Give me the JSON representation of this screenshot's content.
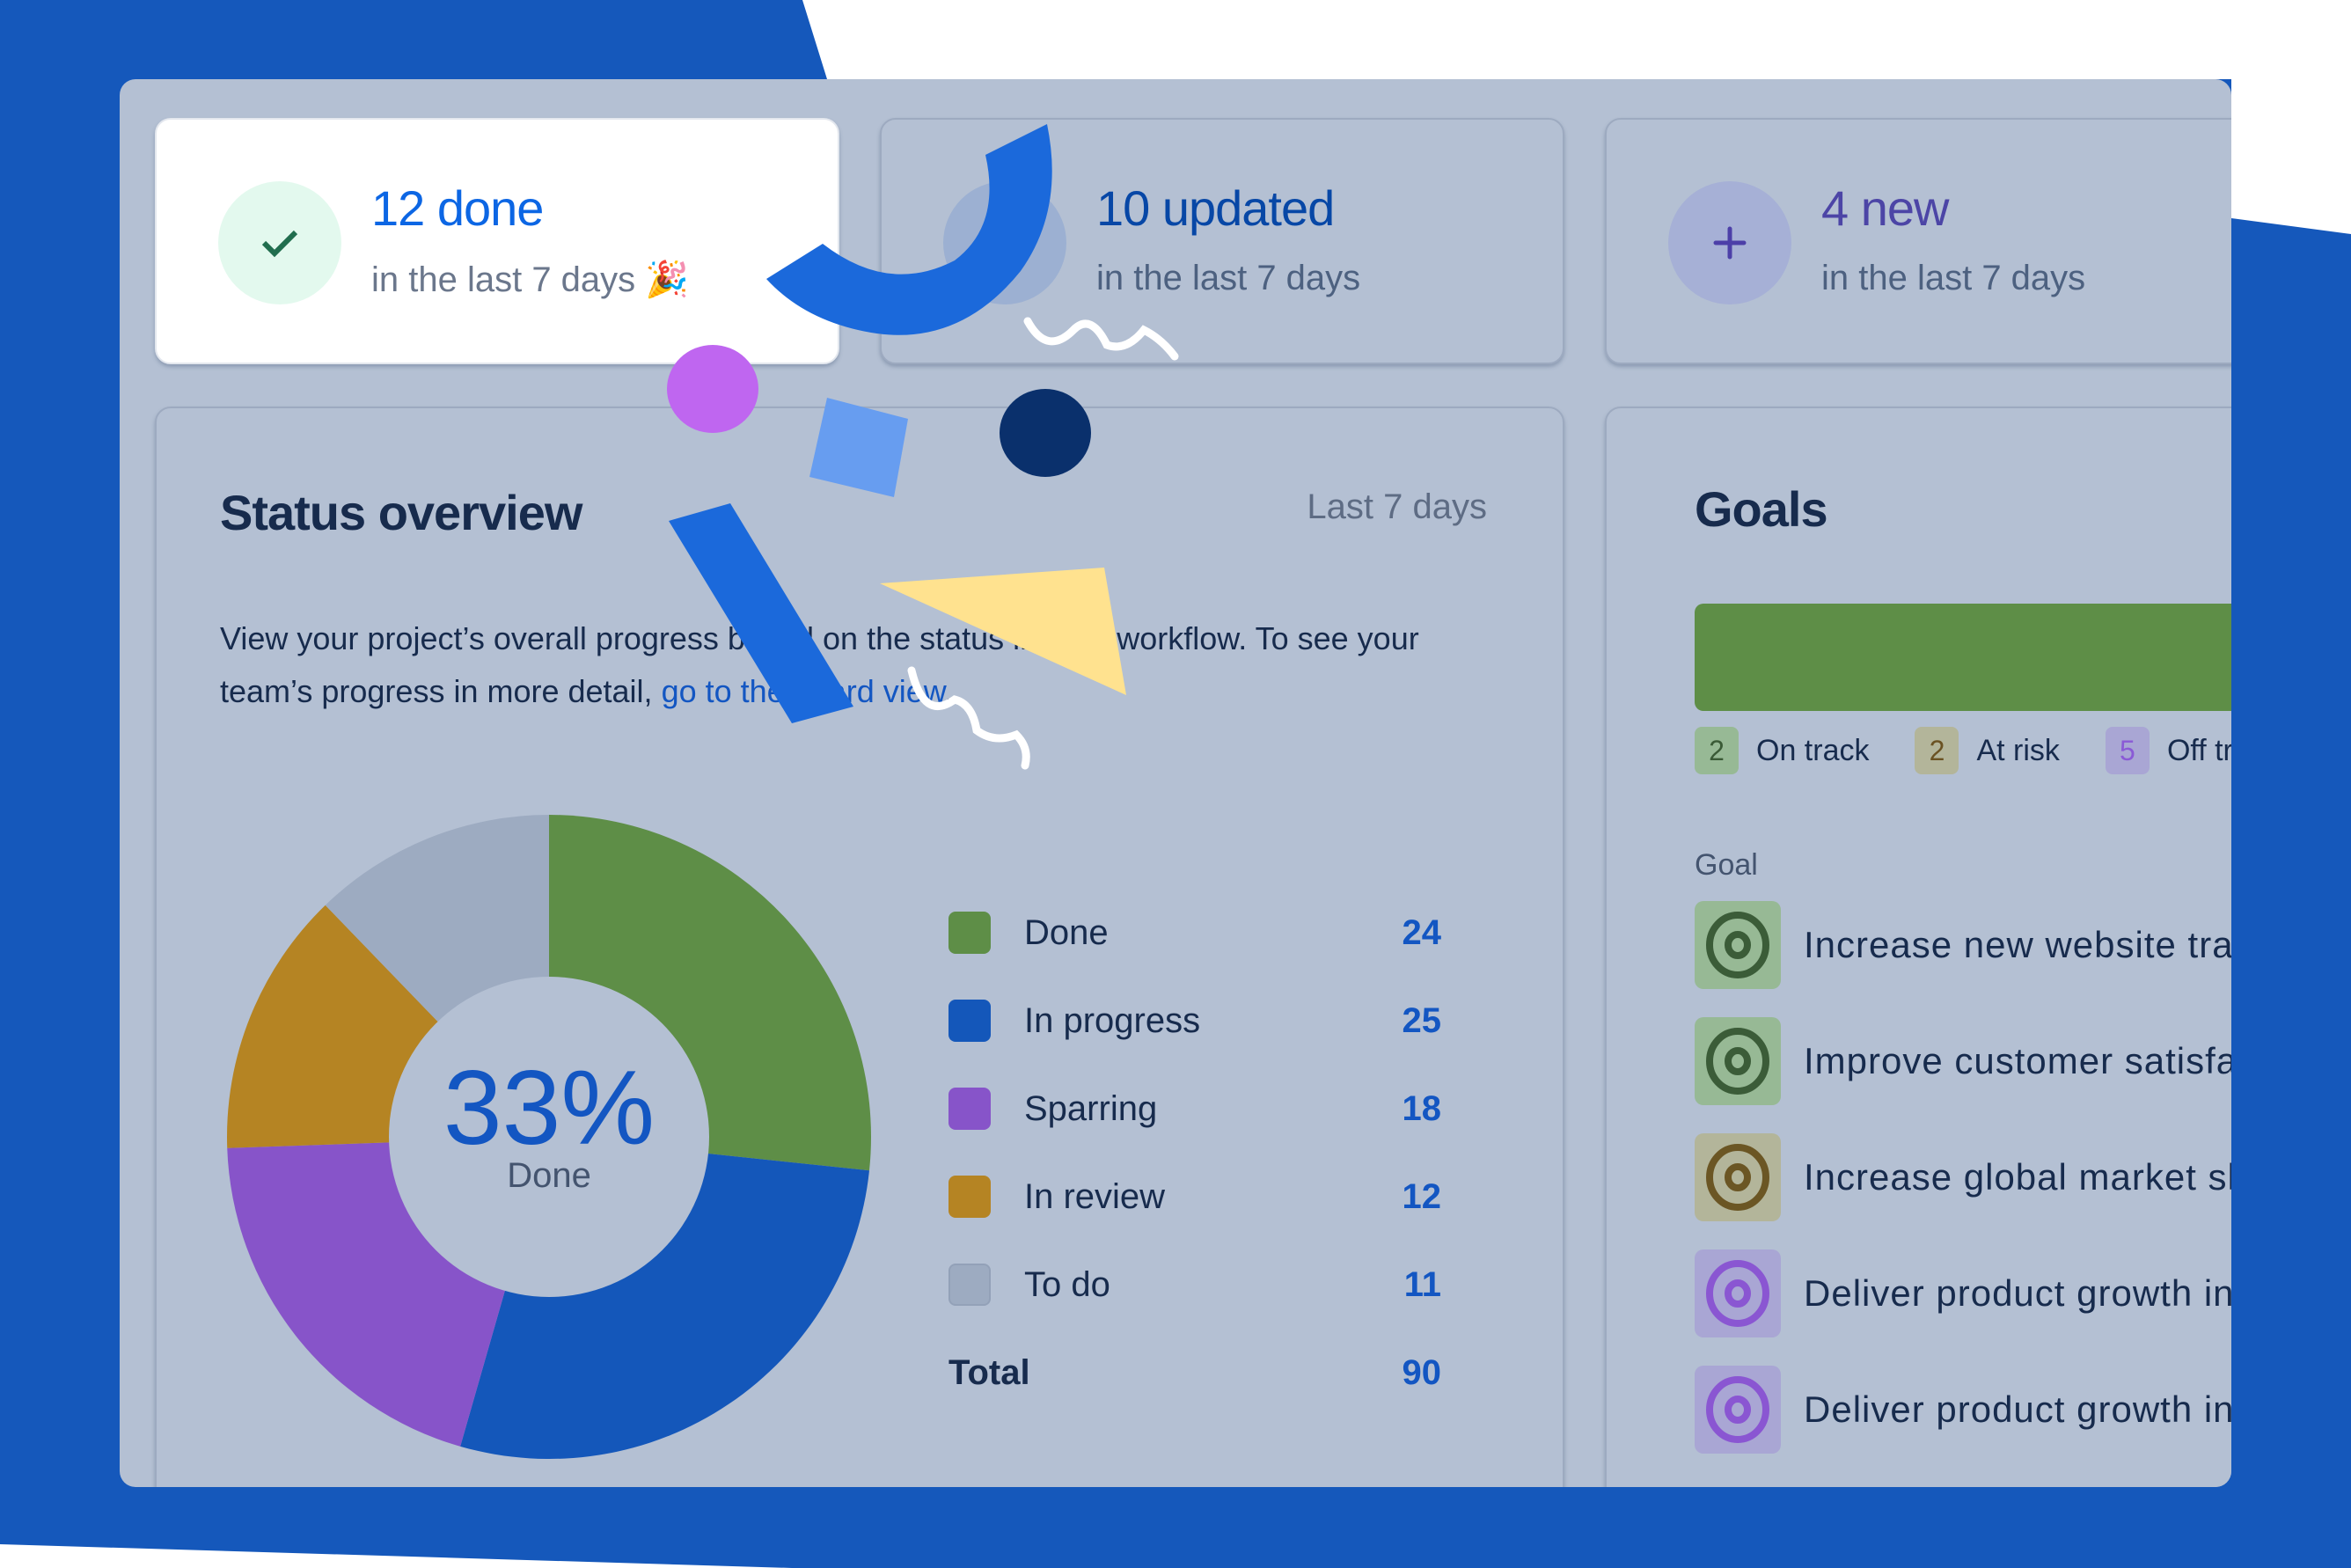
{
  "stats": [
    {
      "title": "12 done",
      "subtitle": "in the last 7 days",
      "emoji": "🎉",
      "icon": "check-icon",
      "title_color": "#0c66e4",
      "icon_bg": "#e3f9ee",
      "icon_color": "#216e4e"
    },
    {
      "title": "10 updated",
      "subtitle": "in the last 7 days",
      "icon": "edit-icon",
      "title_color": "#0747a6",
      "icon_bg": "#9cb0d2",
      "icon_color": "#0747a6"
    },
    {
      "title": "4 new",
      "subtitle": "in the last 7 days",
      "icon": "plus-icon",
      "title_color": "#4c45a6",
      "icon_bg": "#a6b0d6",
      "icon_color": "#4c3fa8"
    }
  ],
  "status_overview": {
    "title": "Status overview",
    "range": "Last 7 days",
    "description_pre": "View your project’s overall progress based on the status in your workflow. To see your team’s progress in more detail, ",
    "description_link": "go to the board view",
    "description_post": ".",
    "center_value": "33%",
    "center_label": "Done",
    "total_label": "Total",
    "total_value": "90"
  },
  "chart_data": {
    "type": "pie",
    "title": "Status overview",
    "center_text": "33% Done",
    "categories": [
      "Done",
      "In progress",
      "Sparring",
      "In review",
      "To do"
    ],
    "values": [
      24,
      25,
      18,
      12,
      11
    ],
    "colors": [
      "#5e8e47",
      "#1457ba",
      "#8754c9",
      "#b58423",
      "#9dabc1"
    ],
    "total": 90,
    "legend": "right"
  },
  "goals": {
    "title": "Goals",
    "bar_color": "#5e8e47",
    "summary": [
      {
        "count": "2",
        "label": "On track",
        "bg": "#97b995",
        "fg": "#3a5a36"
      },
      {
        "count": "2",
        "label": "At risk",
        "bg": "#b3b59a",
        "fg": "#6a5222"
      },
      {
        "count": "5",
        "label": "Off track",
        "bg": "#a9a6d4",
        "fg": "#8a5ad6"
      }
    ],
    "column_header": "Goal",
    "items": [
      {
        "label": "Increase new website traffic",
        "bg": "#97b995",
        "fg": "#3b5c38"
      },
      {
        "label": "Improve customer satisfaction",
        "bg": "#97b995",
        "fg": "#3b5c38"
      },
      {
        "label": "Increase global market share",
        "bg": "#b3b59a",
        "fg": "#6b5624"
      },
      {
        "label": "Deliver product growth initiatives",
        "bg": "#a9a6d4",
        "fg": "#8a56d2"
      },
      {
        "label": "Deliver product growth initiatives",
        "bg": "#a9a6d4",
        "fg": "#8a56d2"
      }
    ]
  }
}
